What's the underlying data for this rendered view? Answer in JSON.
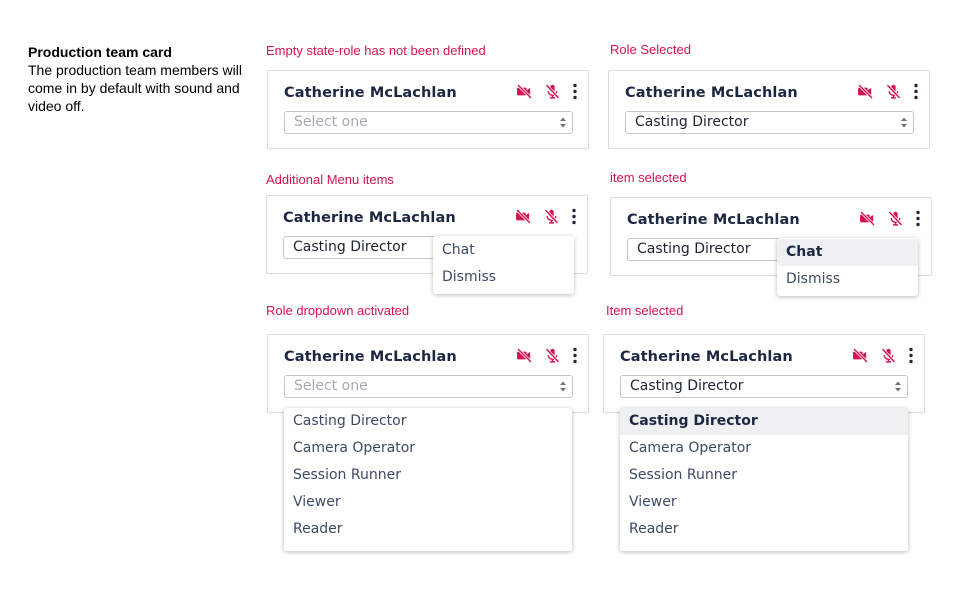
{
  "intro": {
    "title": "Production team card",
    "description": "The production team members will come in by default with sound and video off."
  },
  "colors": {
    "accent": "#d6124e",
    "name_text": "#1c2842",
    "menu_text": "#3e4a64",
    "border": "#d8dbe0"
  },
  "icons": {
    "video": "video-off-icon",
    "mic": "mic-off-icon",
    "menu": "more-vertical-icon",
    "select": "chevron-up-down-icon"
  },
  "variants": [
    {
      "label": "Empty state-role has not been defined",
      "name": "Catherine McLachlan",
      "select_value": "Select one",
      "select_is_placeholder": true
    },
    {
      "label": "Role Selected",
      "name": "Catherine McLachlan",
      "select_value": "Casting Director",
      "select_is_placeholder": false
    },
    {
      "label": "Additional Menu items",
      "name": "Catherine McLachlan",
      "select_value": "Casting Director",
      "select_is_placeholder": false,
      "menu": {
        "items": [
          "Chat",
          "Dismiss"
        ],
        "selected": null
      }
    },
    {
      "label": "item selected",
      "name": "Catherine McLachlan",
      "select_value": "Casting Director",
      "select_is_placeholder": false,
      "menu": {
        "items": [
          "Chat",
          "Dismiss"
        ],
        "selected": "Chat"
      }
    },
    {
      "label": "Role dropdown activated",
      "name": "Catherine McLachlan",
      "select_value": "Select one",
      "select_is_placeholder": true,
      "dropdown": {
        "options": [
          "Casting Director",
          "Camera Operator",
          "Session Runner",
          "Viewer",
          "Reader"
        ],
        "selected": null
      }
    },
    {
      "label": "Item selected",
      "name": "Catherine McLachlan",
      "select_value": "Casting Director",
      "select_is_placeholder": false,
      "dropdown": {
        "options": [
          "Casting Director",
          "Camera Operator",
          "Session Runner",
          "Viewer",
          "Reader"
        ],
        "selected": "Casting Director"
      }
    }
  ]
}
